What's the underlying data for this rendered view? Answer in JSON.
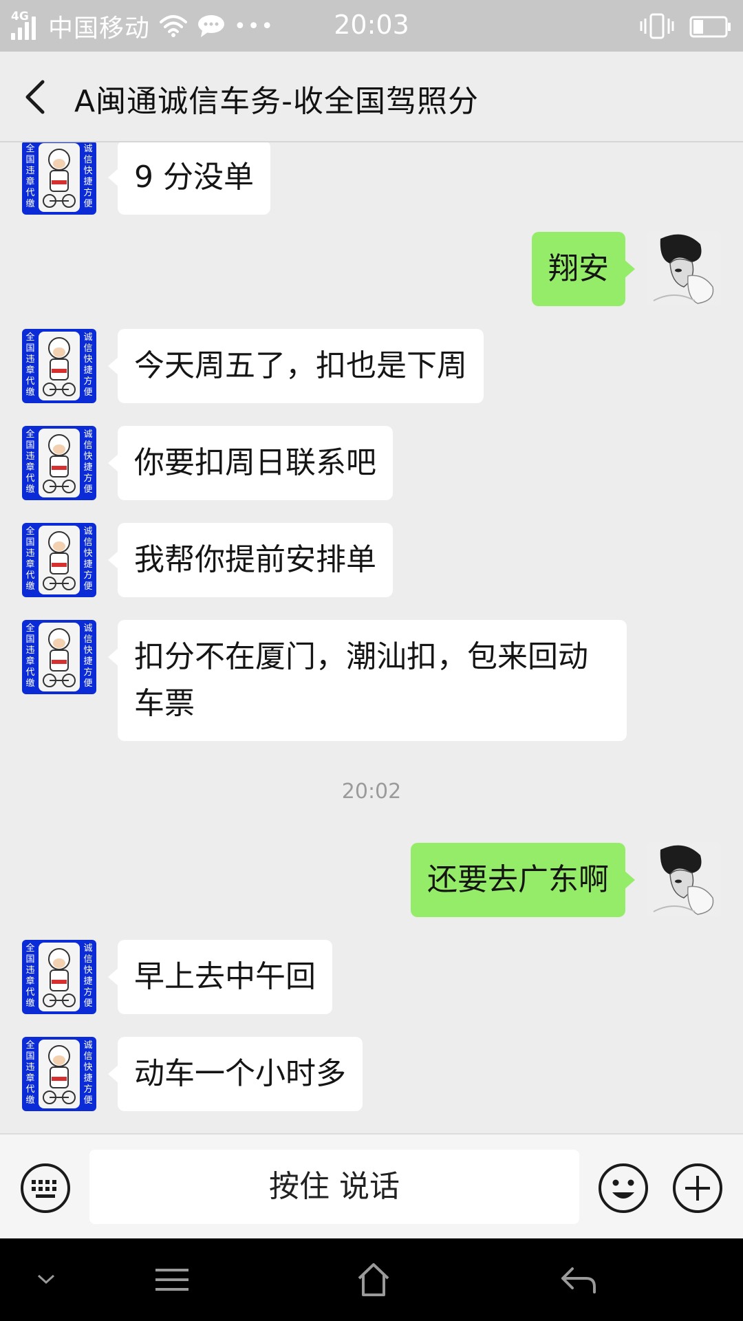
{
  "status_bar": {
    "network": "4G",
    "carrier": "中国移动",
    "time": "20:03",
    "icons": [
      "signal-icon",
      "wifi-icon",
      "message-icon",
      "more-dots-icon",
      "vibrate-icon",
      "battery-icon"
    ]
  },
  "header": {
    "title": "A闽通诚信车务-收全国驾照分",
    "back_icon": "chevron-left-icon"
  },
  "messages": [
    {
      "side": "in",
      "text": "9 分没单"
    },
    {
      "side": "out",
      "text": "翔安"
    },
    {
      "side": "in",
      "text": "今天周五了，扣也是下周"
    },
    {
      "side": "in",
      "text": "你要扣周日联系吧"
    },
    {
      "side": "in",
      "text": "我帮你提前安排单"
    },
    {
      "side": "in",
      "text_line1": "扣分不在厦门，潮汕扣，包来回动",
      "text_line2": "车票"
    },
    {
      "type": "time",
      "text": "20:02"
    },
    {
      "side": "out",
      "text": "还要去广东啊"
    },
    {
      "side": "in",
      "text": "早上去中午回"
    },
    {
      "side": "in",
      "text": "动车一个小时多"
    }
  ],
  "avatars": {
    "left_avatar_text": [
      "全",
      "国",
      "违",
      "章",
      "代",
      "缴"
    ],
    "right_avatar_text": [
      "诚",
      "信",
      "快",
      "捷",
      "方",
      "便"
    ]
  },
  "input_bar": {
    "hold_to_talk_label": "按住 说话"
  },
  "colors": {
    "background": "#ededed",
    "incoming_bubble": "#ffffff",
    "outgoing_bubble": "#95ec69",
    "status_bar": "#c7c7c7",
    "avatar_blue": "#0a2bd6"
  }
}
